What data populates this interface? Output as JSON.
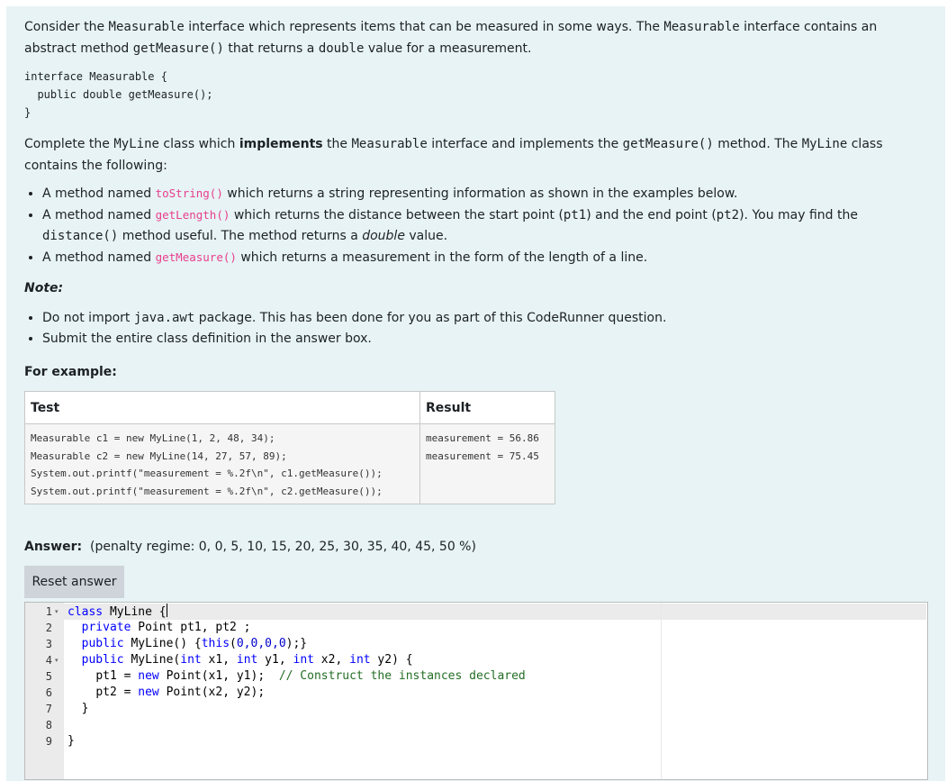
{
  "intro": {
    "t1": "Consider the ",
    "c1": "Measurable",
    "t2": " interface which represents items that can be measured in some ways. The ",
    "c2": "Measurable",
    "t3": " interface contains an abstract method ",
    "c3": "getMeasure()",
    "t4": " that returns a ",
    "c4": "double",
    "t5": " value for a measurement."
  },
  "interface_code": "interface Measurable {\n  public double getMeasure();\n}",
  "complete": {
    "t1": "Complete the ",
    "c1": "MyLine",
    "t2": " class which ",
    "b1": "implements",
    "t3": " the ",
    "c2": "Measurable",
    "t4": " interface and implements the ",
    "c3": "getMeasure()",
    "t5": " method. The ",
    "c4": "MyLine",
    "t6": " class contains the following:"
  },
  "bullets": [
    {
      "a": "A method named ",
      "code": "toString()",
      "b": " which returns a string representing information as shown in the examples below."
    },
    {
      "a": "A method named ",
      "code": "getLength()",
      "b": " which returns the distance between the start point (",
      "c1": "pt1",
      "d": ") and the end point (",
      "c2": "pt2",
      "e": "). You may find the ",
      "c3": "distance()",
      "f": " method useful. The method returns a ",
      "i": "double",
      "g": " value."
    },
    {
      "a": "A method named ",
      "code": "getMeasure()",
      "b": " which returns a measurement in the form of the length of a line."
    }
  ],
  "note": {
    "title": "Note:",
    "items": [
      {
        "a": "Do not import ",
        "code": "java.awt",
        "b": " package. This has been done for you as part of this CodeRunner question."
      },
      {
        "a": "Submit the entire class definition in the answer box."
      }
    ]
  },
  "example": {
    "title": "For example:",
    "col_test": "Test",
    "col_result": "Result",
    "test": "Measurable c1 = new MyLine(1, 2, 48, 34);\nMeasurable c2 = new MyLine(14, 27, 57, 89);\nSystem.out.printf(\"measurement = %.2f\\n\", c1.getMeasure());\nSystem.out.printf(\"measurement = %.2f\\n\", c2.getMeasure());",
    "result": "measurement = 56.86\nmeasurement = 75.45"
  },
  "answer": {
    "label": "Answer:",
    "penalty": "(penalty regime: 0, 0, 5, 10, 15, 20, 25, 30, 35, 40, 45, 50 %)",
    "reset_label": "Reset answer"
  },
  "editor": {
    "line_numbers": [
      "1",
      "2",
      "3",
      "4",
      "5",
      "6",
      "7",
      "8",
      "9"
    ],
    "fold_icon": "▾",
    "lines": {
      "l1": {
        "kw": "class",
        "rest": " MyLine {"
      },
      "l2": {
        "indent": "  ",
        "kw": "private",
        "rest": " Point pt1, pt2 ;"
      },
      "l3": {
        "indent": "  ",
        "kw": "public",
        "a": " MyLine() {",
        "kw2": "this",
        "b": "(",
        "n": "0,0,0,0",
        "c": ");}"
      },
      "l4": {
        "indent": "  ",
        "kw": "public",
        "a": " MyLine(",
        "kw2": "int",
        "b": " x1, ",
        "kw3": "int",
        "c": " y1, ",
        "kw4": "int",
        "d": " x2, ",
        "kw5": "int",
        "e": " y2) {"
      },
      "l5": {
        "indent": "    ",
        "a": "pt1 = ",
        "kw": "new",
        "b": " Point(x1, y1);  ",
        "cm": "// Construct the instances declared"
      },
      "l6": {
        "indent": "    ",
        "a": "pt2 = ",
        "kw": "new",
        "b": " Point(x2, y2);"
      },
      "l7": {
        "indent": "  ",
        "a": "}"
      },
      "l9": {
        "a": "}"
      }
    }
  }
}
